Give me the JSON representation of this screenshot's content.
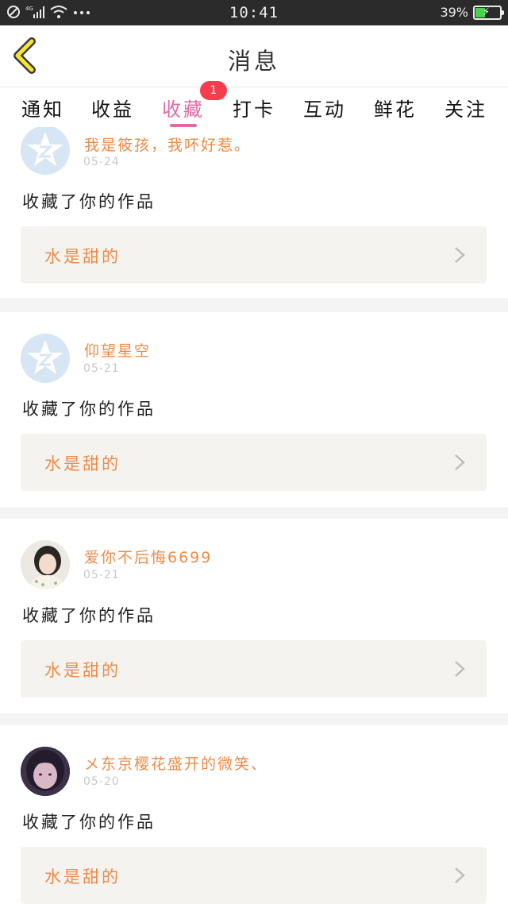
{
  "status_bar": {
    "time": "10:41",
    "battery": "39%",
    "battery_level": 0.39
  },
  "header": {
    "title": "消息"
  },
  "tabs": [
    {
      "label": "通知"
    },
    {
      "label": "收益"
    },
    {
      "label": "收藏",
      "active": true,
      "badge": "1"
    },
    {
      "label": "打卡"
    },
    {
      "label": "互动"
    },
    {
      "label": "鲜花"
    },
    {
      "label": "关注"
    }
  ],
  "notifications": [
    {
      "nickname": "我是筱孩，我吥好惹。",
      "date": "05-24",
      "action": "收藏了你的作品",
      "work_title": "水是甜的"
    },
    {
      "nickname": "仰望星空",
      "date": "05-21",
      "action": "收藏了你的作品",
      "work_title": "水是甜的"
    },
    {
      "nickname": "爱你不后悔6699",
      "date": "05-21",
      "action": "收藏了你的作品",
      "work_title": "水是甜的"
    },
    {
      "nickname": "メ东京樱花盛开的微笑、",
      "date": "05-20",
      "action": "收藏了你的作品",
      "work_title": "水是甜的"
    }
  ],
  "colors": {
    "accent_pink": "#e569a3",
    "nickname_orange": "#f08a46",
    "badge_red": "#f53d4b",
    "work_bg": "#f4f3ef"
  }
}
